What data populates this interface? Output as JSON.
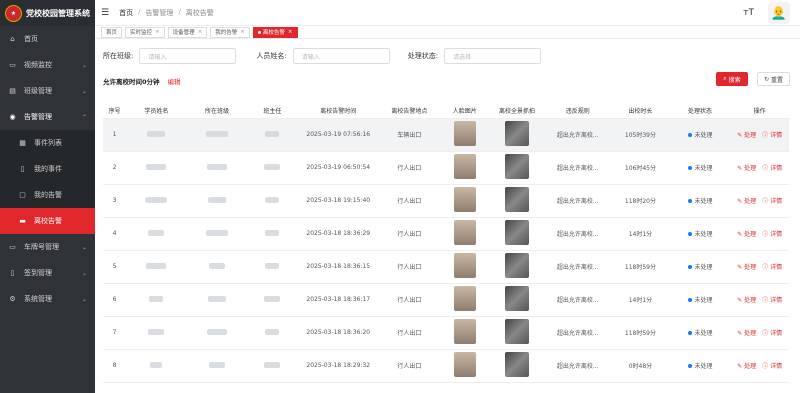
{
  "app": {
    "title": "党校校园管理系统"
  },
  "sidebar": {
    "items": [
      {
        "label": "首页",
        "icon": "home-icon"
      },
      {
        "label": "视频监控",
        "icon": "video-icon"
      },
      {
        "label": "班级管理",
        "icon": "class-icon"
      },
      {
        "label": "告警管理",
        "icon": "alarm-icon"
      },
      {
        "label": "事件列表",
        "icon": "list-icon"
      },
      {
        "label": "我的事件",
        "icon": "book-icon"
      },
      {
        "label": "我的告警",
        "icon": "doc-icon"
      },
      {
        "label": "离校告警",
        "icon": "leave-icon"
      },
      {
        "label": "车牌号管理",
        "icon": "car-icon"
      },
      {
        "label": "签到管理",
        "icon": "checkin-icon"
      },
      {
        "label": "系统管理",
        "icon": "gear-icon"
      }
    ]
  },
  "breadcrumb": [
    "首页",
    "告警管理",
    "离校告警"
  ],
  "tabs": [
    "首页",
    "实时监控",
    "设备管理",
    "我的告警",
    "离校告警"
  ],
  "filters": {
    "class_label": "所在班级:",
    "class_placeholder": "请输入",
    "name_label": "人员姓名:",
    "name_placeholder": "请输入",
    "status_label": "处理状态:",
    "status_placeholder": "请选择"
  },
  "limit": {
    "text": "允许离校时间0分钟",
    "edit": "编辑"
  },
  "buttons": {
    "search": "搜索",
    "reset": "重置"
  },
  "table": {
    "headers": [
      "序号",
      "学员姓名",
      "所在班级",
      "班主任",
      "离校告警时间",
      "离校告警地点",
      "人脸图片",
      "离校全景抓拍",
      "违反规则",
      "出校时长",
      "处理状态",
      "操作"
    ],
    "rows": [
      {
        "no": "1",
        "time": "2025-03-19 07:56:16",
        "place": "车辆出口",
        "rule": "超出允许离校...",
        "duration": "105时39分",
        "status": "未处理"
      },
      {
        "no": "2",
        "time": "2025-03-19 06:50:54",
        "place": "行人出口",
        "rule": "超出允许离校...",
        "duration": "106时45分",
        "status": "未处理"
      },
      {
        "no": "3",
        "time": "2025-03-18 19:15:40",
        "place": "行人出口",
        "rule": "超出允许离校...",
        "duration": "118时20分",
        "status": "未处理"
      },
      {
        "no": "4",
        "time": "2025-03-18 18:36:29",
        "place": "行人出口",
        "rule": "超出允许离校...",
        "duration": "14时1分",
        "status": "未处理"
      },
      {
        "no": "5",
        "time": "2025-03-18 18:36:15",
        "place": "行人出口",
        "rule": "超出允许离校...",
        "duration": "118时59分",
        "status": "未处理"
      },
      {
        "no": "6",
        "time": "2025-03-18 18:36:17",
        "place": "行人出口",
        "rule": "超出允许离校...",
        "duration": "14时1分",
        "status": "未处理"
      },
      {
        "no": "7",
        "time": "2025-03-18 18:36:20",
        "place": "行人出口",
        "rule": "超出允许离校...",
        "duration": "118时59分",
        "status": "未处理"
      },
      {
        "no": "8",
        "time": "2025-03-18 18:29:32",
        "place": "行人出口",
        "rule": "超出允许离校...",
        "duration": "0时48分",
        "status": "未处理"
      }
    ],
    "action_handle": "处理",
    "action_detail": "详情"
  },
  "colors": {
    "accent": "#e0282c",
    "sidebar": "#2f3236",
    "status_dot": "#1677ff"
  }
}
